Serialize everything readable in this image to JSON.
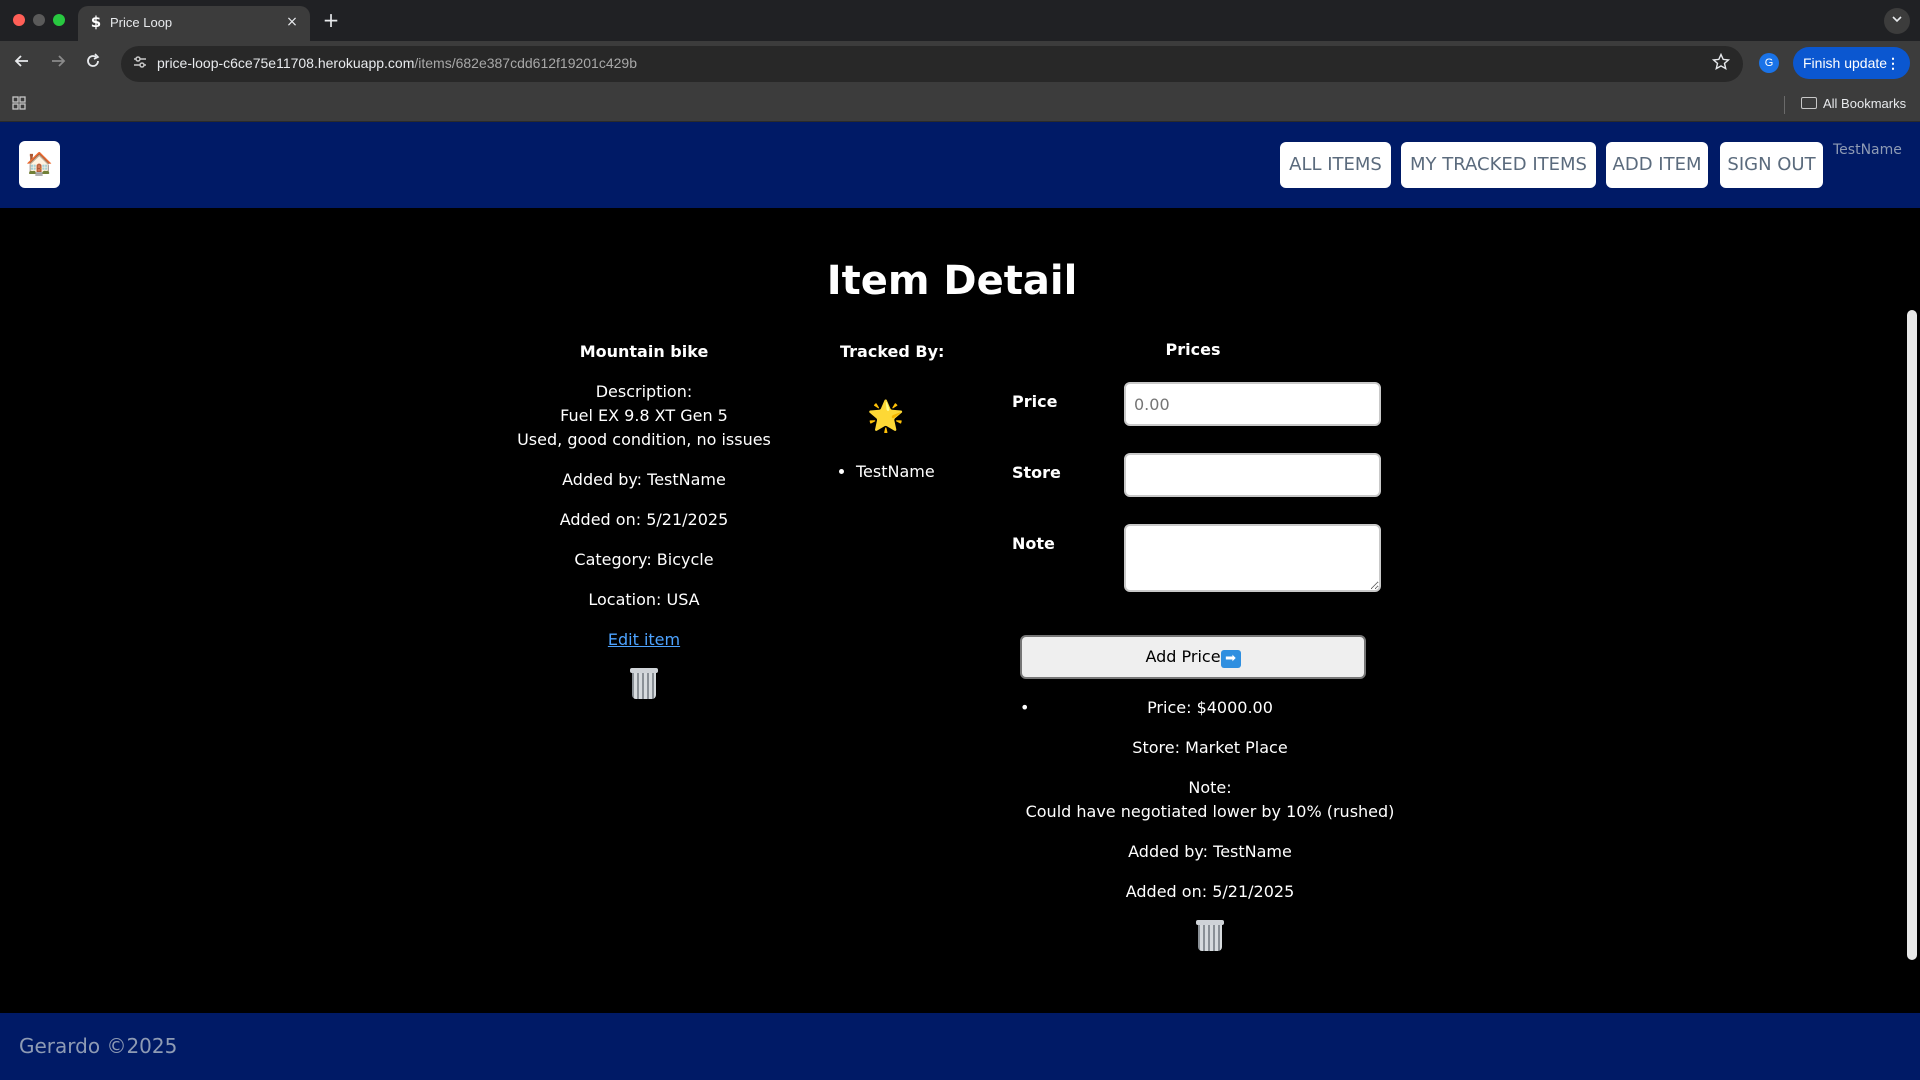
{
  "browser": {
    "tab_title": "Price Loop",
    "tab_favicon": "$",
    "tab_close": "×",
    "new_tab": "+",
    "url_host": "price-loop-c6ce75e11708.herokuapp.com",
    "url_path": "/items/682e387cdd612f19201c429b",
    "profile_initial": "G",
    "finish_update_label": "Finish update",
    "all_bookmarks_label": "All Bookmarks",
    "icons": {
      "back": "arrow-left-icon",
      "forward": "arrow-right-icon",
      "reload": "reload-icon",
      "site_info": "tune-icon",
      "star": "star-icon",
      "apps": "apps-grid-icon",
      "folder": "folder-icon",
      "tab_search": "chevron-down-icon"
    }
  },
  "header": {
    "home_icon": "🏠",
    "nav": [
      "ALL ITEMS",
      "MY TRACKED ITEMS",
      "ADD ITEM",
      "SIGN OUT"
    ],
    "user": "TestName",
    "background": "#001a66"
  },
  "page": {
    "title": "Item Detail"
  },
  "item": {
    "name": "Mountain bike",
    "description_label": "Description:",
    "description_line1": "Fuel EX 9.8 XT Gen 5",
    "description_line2": "Used, good condition, no issues",
    "added_by": "Added by: TestName",
    "added_on": "Added on: 5/21/2025",
    "category": "Category: Bicycle",
    "location": "Location: USA",
    "edit_label": "Edit item",
    "delete_icon": "trash-can-icon"
  },
  "tracked": {
    "heading": "Tracked By:",
    "badge_icon": "🌟",
    "users": [
      "TestName"
    ]
  },
  "prices": {
    "heading": "Prices",
    "form": {
      "price_label": "Price",
      "price_placeholder": "0.00",
      "store_label": "Store",
      "note_label": "Note",
      "submit_label": "Add Price",
      "submit_icon": "➡"
    },
    "entries": [
      {
        "price": "Price: $4000.00",
        "store": "Store: Market Place",
        "note_label": "Note:",
        "note": "Could have negotiated lower by 10% (rushed)",
        "added_by": "Added by: TestName",
        "added_on": "Added on: 5/21/2025"
      }
    ]
  },
  "footer": {
    "text": "Gerardo ©2025"
  }
}
